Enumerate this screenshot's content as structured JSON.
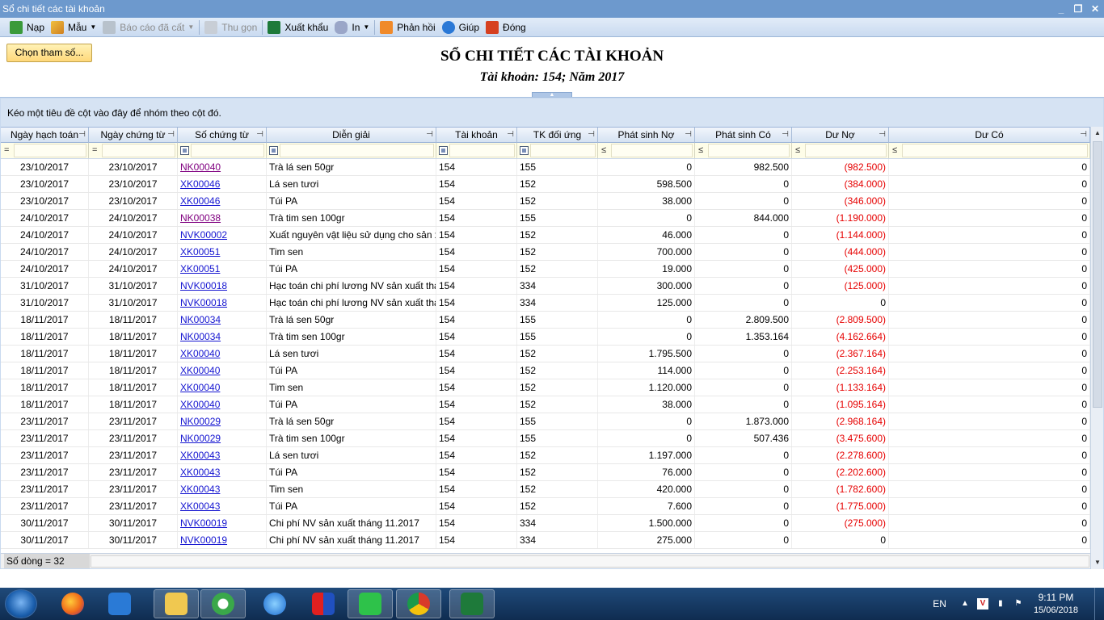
{
  "window": {
    "title": "Sổ chi tiết các tài khoản"
  },
  "toolbar": {
    "nap": "Nạp",
    "mau": "Mẫu",
    "bao_cao_da_cat": "Báo cáo đã cất",
    "thu_gon": "Thu gọn",
    "xuat_khau": "Xuất khẩu",
    "in": "In",
    "phan_hoi": "Phản hồi",
    "giup": "Giúp",
    "dong": "Đóng"
  },
  "chon_tham_so": "Chọn tham số...",
  "report": {
    "title": "SỔ CHI TIẾT CÁC TÀI KHOẢN",
    "subtitle": "Tài khoản: 154; Năm 2017"
  },
  "grid": {
    "group_panel": "Kéo một tiêu đề cột vào đây để nhóm theo cột đó.",
    "columns": [
      "Ngày hạch toán",
      "Ngày chứng từ",
      "Số chứng từ",
      "Diễn giải",
      "Tài khoản",
      "TK đối ứng",
      "Phát sinh Nợ",
      "Phát sinh Có",
      "Dư Nợ",
      "Dư Có"
    ],
    "filter_ops": [
      "=",
      "=",
      "",
      "",
      "",
      "",
      "≤",
      "≤",
      "≤",
      "≤"
    ],
    "rows": [
      [
        "23/10/2017",
        "23/10/2017",
        "NK00040",
        "Trà lá sen 50gr",
        "154",
        "155",
        "0",
        "982.500",
        "(982.500)",
        "0"
      ],
      [
        "23/10/2017",
        "23/10/2017",
        "XK00046",
        "Lá sen tươi",
        "154",
        "152",
        "598.500",
        "0",
        "(384.000)",
        "0"
      ],
      [
        "23/10/2017",
        "23/10/2017",
        "XK00046",
        "Túi PA",
        "154",
        "152",
        "38.000",
        "0",
        "(346.000)",
        "0"
      ],
      [
        "24/10/2017",
        "24/10/2017",
        "NK00038",
        "Trà tim sen 100gr",
        "154",
        "155",
        "0",
        "844.000",
        "(1.190.000)",
        "0"
      ],
      [
        "24/10/2017",
        "24/10/2017",
        "NVK00002",
        "Xuất nguyên vật liệu sử dụng cho sản x",
        "154",
        "152",
        "46.000",
        "0",
        "(1.144.000)",
        "0"
      ],
      [
        "24/10/2017",
        "24/10/2017",
        "XK00051",
        "Tim sen",
        "154",
        "152",
        "700.000",
        "0",
        "(444.000)",
        "0"
      ],
      [
        "24/10/2017",
        "24/10/2017",
        "XK00051",
        "Túi PA",
        "154",
        "152",
        "19.000",
        "0",
        "(425.000)",
        "0"
      ],
      [
        "31/10/2017",
        "31/10/2017",
        "NVK00018",
        "Hạc toán chi phí lương NV sản xuất thán",
        "154",
        "334",
        "300.000",
        "0",
        "(125.000)",
        "0"
      ],
      [
        "31/10/2017",
        "31/10/2017",
        "NVK00018",
        "Hạc toán chi phí lương NV sản xuất thán",
        "154",
        "334",
        "125.000",
        "0",
        "0",
        "0"
      ],
      [
        "18/11/2017",
        "18/11/2017",
        "NK00034",
        "Trà lá sen 50gr",
        "154",
        "155",
        "0",
        "2.809.500",
        "(2.809.500)",
        "0"
      ],
      [
        "18/11/2017",
        "18/11/2017",
        "NK00034",
        "Trà tim sen 100gr",
        "154",
        "155",
        "0",
        "1.353.164",
        "(4.162.664)",
        "0"
      ],
      [
        "18/11/2017",
        "18/11/2017",
        "XK00040",
        "Lá sen tươi",
        "154",
        "152",
        "1.795.500",
        "0",
        "(2.367.164)",
        "0"
      ],
      [
        "18/11/2017",
        "18/11/2017",
        "XK00040",
        "Túi PA",
        "154",
        "152",
        "114.000",
        "0",
        "(2.253.164)",
        "0"
      ],
      [
        "18/11/2017",
        "18/11/2017",
        "XK00040",
        "Tim sen",
        "154",
        "152",
        "1.120.000",
        "0",
        "(1.133.164)",
        "0"
      ],
      [
        "18/11/2017",
        "18/11/2017",
        "XK00040",
        "Túi PA",
        "154",
        "152",
        "38.000",
        "0",
        "(1.095.164)",
        "0"
      ],
      [
        "23/11/2017",
        "23/11/2017",
        "NK00029",
        "Trà lá sen 50gr",
        "154",
        "155",
        "0",
        "1.873.000",
        "(2.968.164)",
        "0"
      ],
      [
        "23/11/2017",
        "23/11/2017",
        "NK00029",
        "Trà tim sen 100gr",
        "154",
        "155",
        "0",
        "507.436",
        "(3.475.600)",
        "0"
      ],
      [
        "23/11/2017",
        "23/11/2017",
        "XK00043",
        "Lá sen tươi",
        "154",
        "152",
        "1.197.000",
        "0",
        "(2.278.600)",
        "0"
      ],
      [
        "23/11/2017",
        "23/11/2017",
        "XK00043",
        "Túi PA",
        "154",
        "152",
        "76.000",
        "0",
        "(2.202.600)",
        "0"
      ],
      [
        "23/11/2017",
        "23/11/2017",
        "XK00043",
        "Tim sen",
        "154",
        "152",
        "420.000",
        "0",
        "(1.782.600)",
        "0"
      ],
      [
        "23/11/2017",
        "23/11/2017",
        "XK00043",
        "Túi PA",
        "154",
        "152",
        "7.600",
        "0",
        "(1.775.000)",
        "0"
      ],
      [
        "30/11/2017",
        "30/11/2017",
        "NVK00019",
        "Chi phí NV sản xuất tháng 11.2017",
        "154",
        "334",
        "1.500.000",
        "0",
        "(275.000)",
        "0"
      ],
      [
        "30/11/2017",
        "30/11/2017",
        "NVK00019",
        "Chi phí NV sản xuất tháng 11.2017",
        "154",
        "334",
        "275.000",
        "0",
        "0",
        "0"
      ]
    ],
    "visited_links": [
      "NK00040",
      "NK00038"
    ],
    "row_count": "Số dòng = 32"
  },
  "taskbar": {
    "lang": "EN",
    "time": "9:11 PM",
    "date": "15/06/2018",
    "apps": [
      "firefox-icon",
      "media-player-icon",
      "file-explorer-icon",
      "coccoc-icon",
      "ie-icon",
      "misa-icon",
      "line-icon",
      "chrome-icon",
      "excel-icon"
    ]
  },
  "colors": {
    "titlebar": "#6d99cd",
    "link": "#1515d1",
    "negative": "#e60000"
  }
}
